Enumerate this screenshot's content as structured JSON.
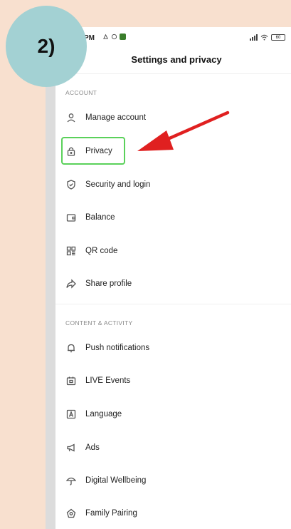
{
  "step_label": "2)",
  "status_bar": {
    "time": "PM",
    "battery": "60"
  },
  "header": {
    "title": "Settings and privacy"
  },
  "sections": [
    {
      "title": "ACCOUNT",
      "items": [
        {
          "label": "Manage account",
          "icon": "person-icon"
        },
        {
          "label": "Privacy",
          "icon": "lock-icon"
        },
        {
          "label": "Security and login",
          "icon": "shield-icon"
        },
        {
          "label": "Balance",
          "icon": "wallet-icon"
        },
        {
          "label": "QR code",
          "icon": "qr-code-icon"
        },
        {
          "label": "Share profile",
          "icon": "share-icon"
        }
      ]
    },
    {
      "title": "CONTENT & ACTIVITY",
      "items": [
        {
          "label": "Push notifications",
          "icon": "bell-icon"
        },
        {
          "label": "LIVE Events",
          "icon": "calendar-icon"
        },
        {
          "label": "Language",
          "icon": "language-icon"
        },
        {
          "label": "Ads",
          "icon": "megaphone-icon"
        },
        {
          "label": "Digital Wellbeing",
          "icon": "umbrella-icon"
        },
        {
          "label": "Family Pairing",
          "icon": "family-icon"
        }
      ]
    }
  ],
  "colors": {
    "background": "#f8e0cf",
    "badge": "#a3d1d3",
    "highlight": "#5ad15a",
    "arrow": "#e02020"
  }
}
